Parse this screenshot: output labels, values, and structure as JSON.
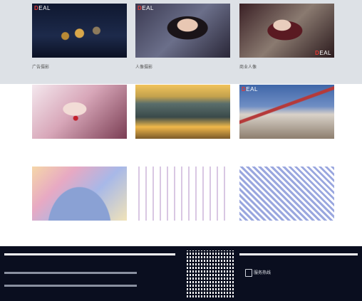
{
  "brand": {
    "logo_text": "EAL",
    "logo_accent": "D"
  },
  "gallery": {
    "items": [
      {
        "caption": "广告摄影",
        "theme": "perfume-bottles"
      },
      {
        "caption": "人像摄影",
        "theme": "portrait-woman"
      },
      {
        "caption": "商业人像",
        "theme": "fashion-portrait"
      },
      {
        "caption": "",
        "theme": "beauty-closeup"
      },
      {
        "caption": "",
        "theme": "stadium-aerial"
      },
      {
        "caption": "",
        "theme": "building-exterior"
      },
      {
        "caption": "",
        "theme": "colorful-abstract-1"
      },
      {
        "caption": "",
        "theme": "abstract-pattern-2"
      },
      {
        "caption": "",
        "theme": "abstract-pattern-3"
      }
    ]
  },
  "footer": {
    "phone_label": "服务热线",
    "phone_number": "",
    "more_link": "",
    "more_sub": ""
  },
  "colors": {
    "footer_bg": "#0a0e1f",
    "accent_red": "#e53935",
    "top_band": "#dde1e6"
  }
}
